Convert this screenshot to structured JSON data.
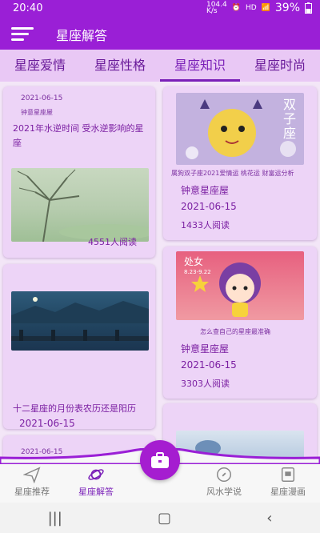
{
  "status": {
    "time": "20:40",
    "speed": "104.4\nK/s",
    "hd": "HD",
    "battery": "39%"
  },
  "appbar": {
    "title": "星座解答"
  },
  "tabs": [
    {
      "label": "星座爱情"
    },
    {
      "label": "星座性格"
    },
    {
      "label": "星座知识"
    },
    {
      "label": "星座时尚"
    }
  ],
  "cards": {
    "c1": {
      "date": "2021-06-15",
      "source": "钟意星座屋",
      "title": "2021年水逆时间 受水逆影响的星座",
      "reads": "4551人阅读"
    },
    "c2": {
      "caption": "属狗双子座2021爱情运 桃花运 财富运分析",
      "source": "钟意星座屋",
      "date": "2021-06-15",
      "reads": "1433人阅读",
      "img_text": "双子座"
    },
    "c3": {
      "title": "十二星座的月份表农历还是阳历",
      "date": "2021-06-15"
    },
    "c4": {
      "caption": "怎么查自己的星座最准确",
      "source": "钟意星座屋",
      "date": "2021-06-15",
      "reads": "3303人阅读",
      "img_label": "处女",
      "img_dates": "8.23-9.22"
    },
    "c5": {
      "date": "2021-06-15"
    }
  },
  "bottomnav": {
    "items": [
      {
        "label": "星座推荐"
      },
      {
        "label": "星座解答"
      },
      {
        "label": "风水学说"
      },
      {
        "label": "星座漫画"
      }
    ]
  },
  "colors": {
    "primary": "#9a1fd6",
    "tab_bg": "#e9c8f5",
    "card_bg": "#edd4f7",
    "text": "#7b1fa2"
  }
}
